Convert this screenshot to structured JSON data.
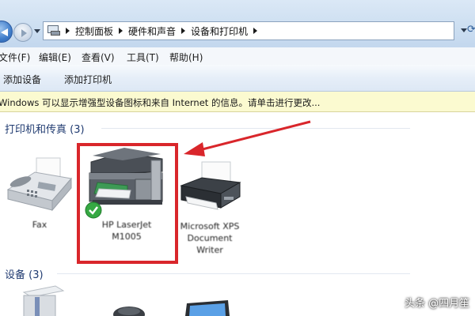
{
  "address": {
    "breadcrumbs": [
      "控制面板",
      "硬件和声音",
      "设备和打印机"
    ]
  },
  "menu": [
    "文件(F)",
    "编辑(E)",
    "查看(V)",
    "工具(T)",
    "帮助(H)"
  ],
  "commands": [
    "添加设备",
    "添加打印机"
  ],
  "infobar": "Windows 可以显示增强型设备图标和来自 Internet 的信息。请单击进行更改...",
  "groups": {
    "printers": {
      "title": "打印机和传真 (3)",
      "items": [
        {
          "label": "Fax"
        },
        {
          "label_lines": [
            "HP LaserJet",
            "M1005"
          ],
          "default": true
        },
        {
          "label_lines": [
            "Microsoft XPS",
            "Document",
            "Writer"
          ]
        }
      ]
    },
    "devices": {
      "title": "设备 (3)"
    }
  },
  "watermark": "头条 @四月笙",
  "colors": {
    "highlight": "#d9262b",
    "group_title": "#1f3a70",
    "infobar_bg": "#fbfad0"
  }
}
